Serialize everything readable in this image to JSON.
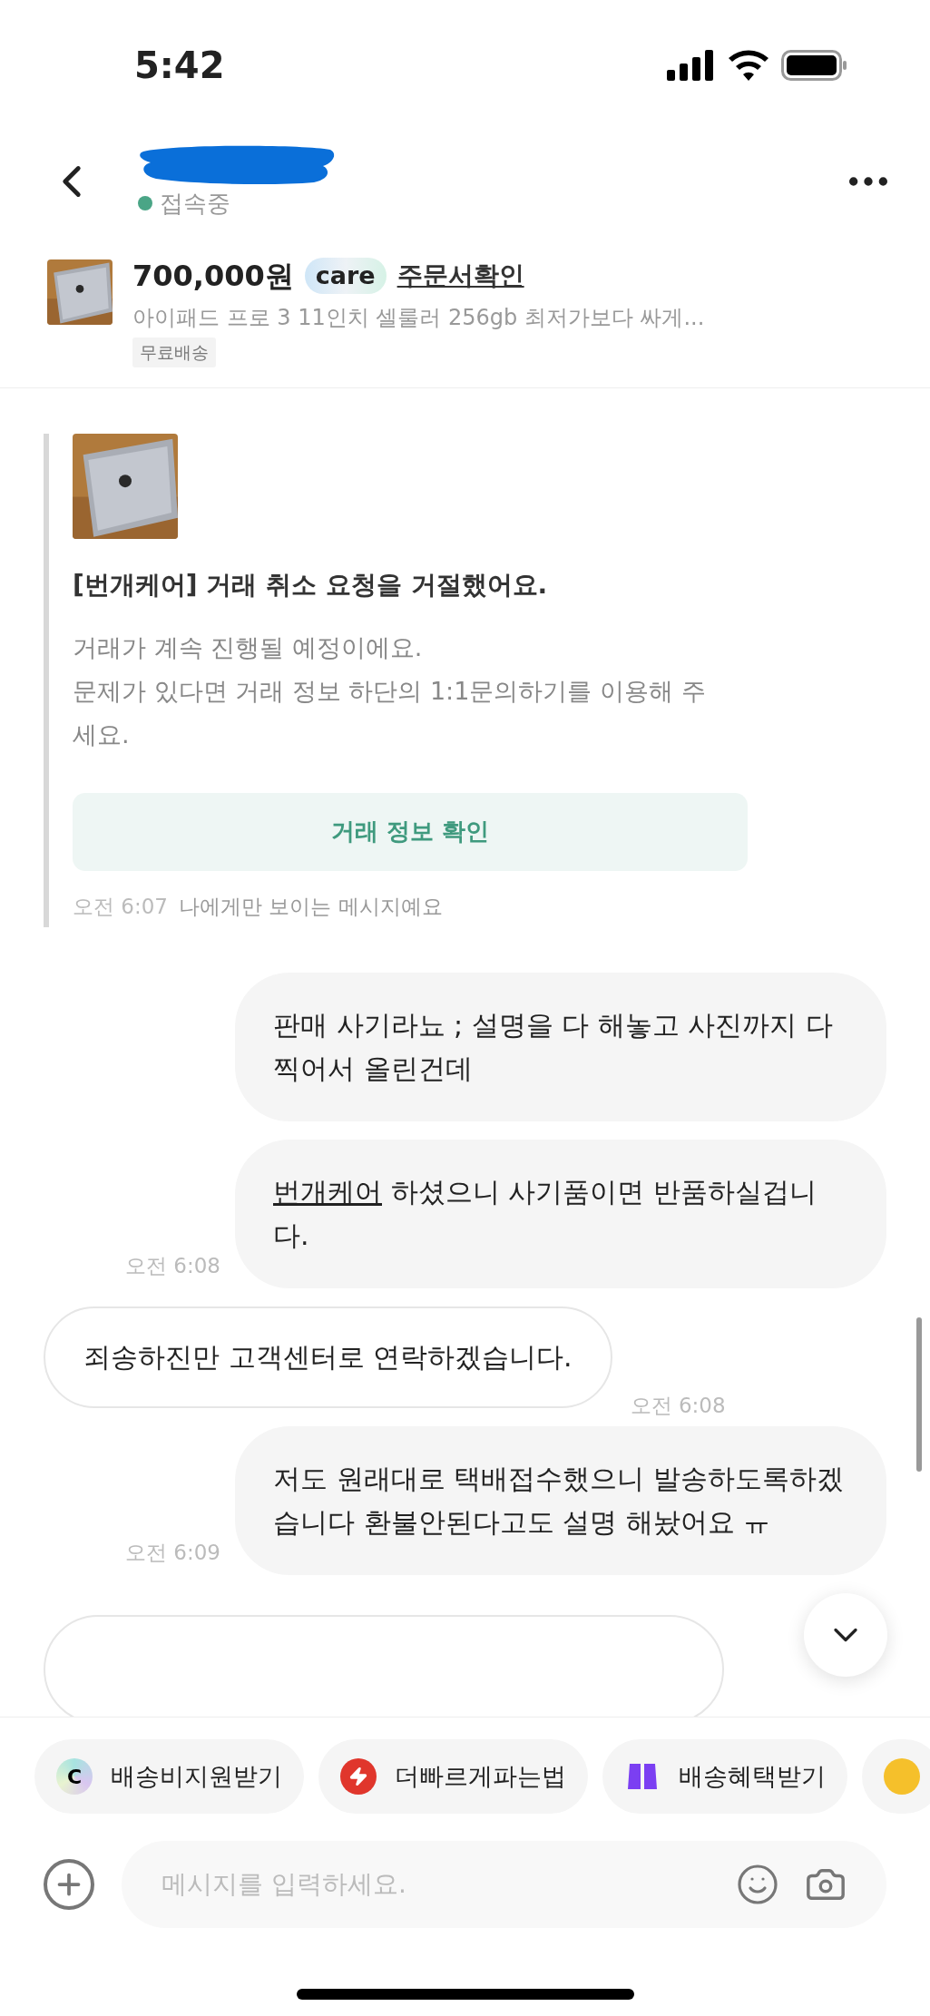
{
  "status_bar": {
    "time": "5:42"
  },
  "header": {
    "status": "접속중",
    "online": true
  },
  "product": {
    "price": "700,000원",
    "badge": "care",
    "order_link": "주문서확인",
    "title": "아이패드 프로 3 11인치 셀룰러 256gb 최저가보다 싸게...",
    "tag": "무료배송"
  },
  "notice": {
    "title": "[번개케어] 거래 취소 요청을 거절했어요.",
    "body": [
      "거래가 계속 진행될 예정이에요.",
      "문제가 있다면 거래 정보 하단의 1:1문의하기를 이용해 주세요."
    ],
    "button": "거래 정보 확인",
    "time": "오전 6:07",
    "note": "나에게만 보이는 메시지예요"
  },
  "messages": [
    {
      "kind": "sent",
      "text": "판매 사기라뇨 ; 설명을 다 해놓고 사진까지 다 찍어서 올린건데"
    },
    {
      "kind": "sent",
      "link": "번개케어",
      "text": " 하셨으니 사기품이면 반품하실겁니다.",
      "time": "오전 6:08"
    },
    {
      "kind": "received",
      "text": "죄송하진만 고객센터로 연락하겠습니다.",
      "time": "오전 6:08"
    },
    {
      "kind": "sent",
      "text": "저도 원래대로 택배접수했으니 발송하도록하겠습니다 환불안된다고도 설명 해놨어요 ㅠ",
      "time": "오전 6:09"
    },
    {
      "kind": "received_cut"
    }
  ],
  "chips": [
    {
      "kind": "logo",
      "icon_text": "C",
      "label": "배송비지원받기"
    },
    {
      "kind": "lightning",
      "label": "더빠르게파는법"
    },
    {
      "kind": "box",
      "label": "배송혜택받기"
    },
    {
      "kind": "coin"
    }
  ],
  "input": {
    "placeholder": "메시지를 입력하세요."
  }
}
